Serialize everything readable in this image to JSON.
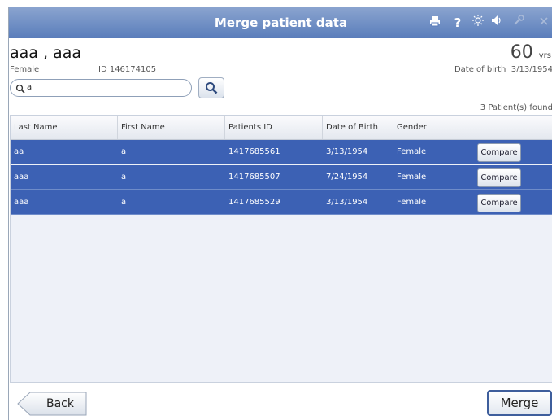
{
  "window": {
    "title": "Merge patient data",
    "icons": [
      "print-icon",
      "help-icon",
      "brightness-icon",
      "volume-icon",
      "wrench-icon",
      "close-icon"
    ]
  },
  "patient": {
    "name": "aaa , aaa",
    "gender": "Female",
    "id_text": "ID 146174105",
    "age": "60",
    "age_unit": "yrs",
    "dob_label": "Date of birth",
    "dob": "3/13/1954"
  },
  "search": {
    "value": "a",
    "placeholder": ""
  },
  "results": {
    "count_text": "3 Patient(s) found",
    "columns": [
      "Last Name",
      "First Name",
      "Patients ID",
      "Date of Birth",
      "Gender",
      ""
    ],
    "rows": [
      {
        "last": "aa",
        "first": "a",
        "pid": "1417685561",
        "dob": "3/13/1954",
        "gender": "Female",
        "action": "Compare"
      },
      {
        "last": "aaa",
        "first": "a",
        "pid": "1417685507",
        "dob": "7/24/1954",
        "gender": "Female",
        "action": "Compare"
      },
      {
        "last": "aaa",
        "first": "a",
        "pid": "1417685529",
        "dob": "3/13/1954",
        "gender": "Female",
        "action": "Compare"
      }
    ]
  },
  "footer": {
    "back_label": "Back",
    "merge_label": "Merge"
  },
  "colors": {
    "titlebar": "#5a7dbb",
    "selected_row": "#3c61b4",
    "merge_border": "#3e5e9c"
  }
}
